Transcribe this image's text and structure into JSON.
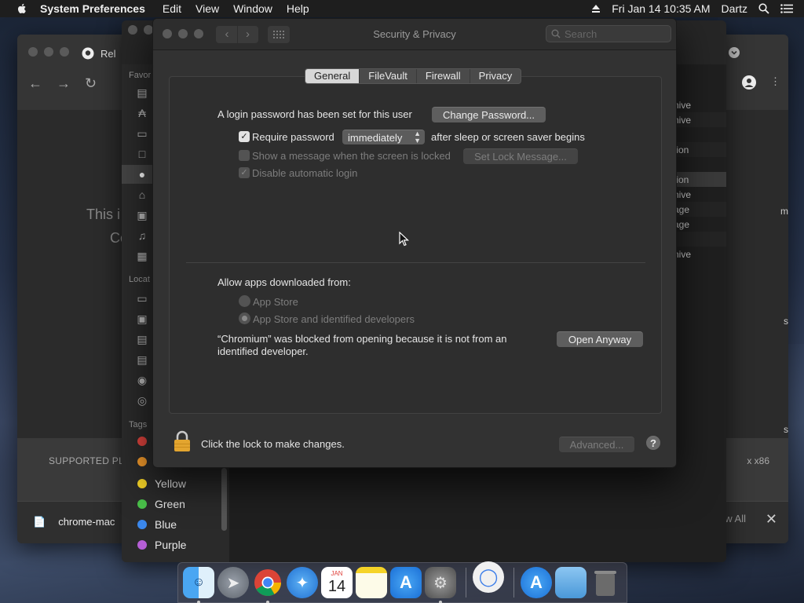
{
  "menubar": {
    "app_name": "System Preferences",
    "menus": [
      "Edit",
      "View",
      "Window",
      "Help"
    ],
    "datetime": "Fri Jan 14  10:35 AM",
    "user": "Dartz"
  },
  "chrome": {
    "tab_title": "Rel",
    "body_line1": "This i",
    "body_line2": "Co",
    "supported_text": "SUPPORTED PLA",
    "mac_text": "x x86",
    "download_file": "chrome-mac",
    "show_all": "w All",
    "side_fragments": [
      "m",
      "s",
      "s"
    ]
  },
  "finder": {
    "favorites_label": "Favor",
    "locations_label": "Locat",
    "tags_label": "Tags",
    "tags": [
      {
        "name": "",
        "color": "#e0443e"
      },
      {
        "name": "",
        "color": "#f39a2b"
      },
      {
        "name": "Yellow",
        "color": "#f5d327"
      },
      {
        "name": "Green",
        "color": "#4ac14a"
      },
      {
        "name": "Blue",
        "color": "#3b88ec"
      },
      {
        "name": "Purple",
        "color": "#b65fd6"
      }
    ],
    "list_rows": [
      "hive",
      "hive",
      "",
      "tion",
      "",
      "tion",
      "hive",
      "age",
      "age",
      "",
      "hive"
    ]
  },
  "window": {
    "title": "Security & Privacy",
    "search_placeholder": "Search"
  },
  "tabs": [
    "General",
    "FileVault",
    "Firewall",
    "Privacy"
  ],
  "general": {
    "login_password_text": "A login password has been set for this user",
    "change_password_button": "Change Password...",
    "require_password_label": "Require password",
    "require_password_checked": true,
    "require_interval": "immediately",
    "after_sleep_text": "after sleep or screen saver begins",
    "show_message_label": "Show a message when the screen is locked",
    "set_lock_message_button": "Set Lock Message...",
    "disable_autologin_label": "Disable automatic login",
    "allow_apps_label": "Allow apps downloaded from:",
    "radio_app_store": "App Store",
    "radio_identified": "App Store and identified developers",
    "blocked_line1": "“Chromium” was blocked from opening because it is not from an",
    "blocked_line2": "identified developer.",
    "open_anyway_button": "Open Anyway"
  },
  "footer": {
    "lock_text": "Click the lock to make changes.",
    "advanced_button": "Advanced...",
    "help_button": "?"
  },
  "dock": {
    "calendar_month": "JAN",
    "calendar_day": "14"
  }
}
